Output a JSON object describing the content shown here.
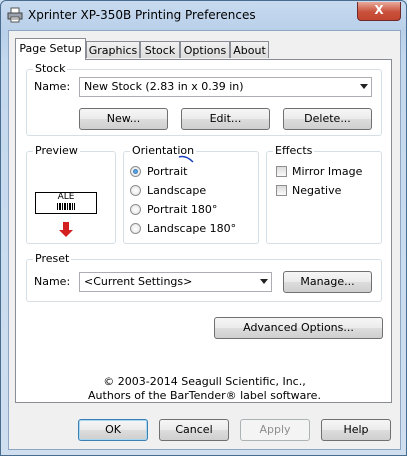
{
  "window": {
    "title": "Xprinter XP-350B Printing Preferences",
    "close_glyph": "X",
    "icon": "printer-icon"
  },
  "tabs": [
    {
      "label": "Page Setup",
      "active": true
    },
    {
      "label": "Graphics",
      "active": false
    },
    {
      "label": "Stock",
      "active": false
    },
    {
      "label": "Options",
      "active": false
    },
    {
      "label": "About",
      "active": false
    }
  ],
  "stock": {
    "group_label": "Stock",
    "name_label": "Name:",
    "selected": "New Stock (2.83 in x 0.39 in)",
    "new_button": "New...",
    "edit_button": "Edit...",
    "delete_button": "Delete..."
  },
  "preview": {
    "group_label": "Preview",
    "label_text": "ALE",
    "arrow_color": "#d32020"
  },
  "orientation": {
    "group_label": "Orientation",
    "options": [
      {
        "label": "Portrait",
        "checked": true
      },
      {
        "label": "Landscape",
        "checked": false
      },
      {
        "label": "Portrait 180°",
        "checked": false
      },
      {
        "label": "Landscape 180°",
        "checked": false
      }
    ]
  },
  "effects": {
    "group_label": "Effects",
    "options": [
      {
        "label": "Mirror Image",
        "checked": false
      },
      {
        "label": "Negative",
        "checked": false
      }
    ]
  },
  "preset": {
    "group_label": "Preset",
    "name_label": "Name:",
    "selected": "<Current Settings>",
    "manage_button": "Manage..."
  },
  "advanced_button": "Advanced Options...",
  "copyright": {
    "line1": "© 2003-2014 Seagull Scientific, Inc.,",
    "line2": "Authors of the BarTender® label software."
  },
  "footer": {
    "ok": "OK",
    "cancel": "Cancel",
    "apply": "Apply",
    "help": "Help"
  },
  "colors": {
    "accent": "#3c7fb1",
    "close_button": "#c7472f"
  }
}
